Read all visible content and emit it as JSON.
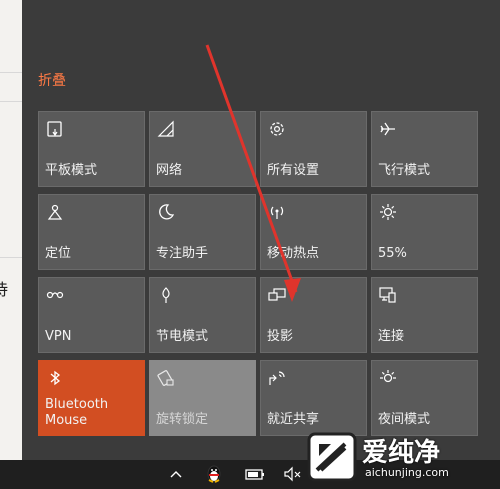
{
  "left_page": {
    "text": "待"
  },
  "panel": {
    "collapse_label": "折叠",
    "tiles": [
      {
        "label": "平板模式",
        "icon": "tablet-mode-icon",
        "state": "normal"
      },
      {
        "label": "网络",
        "icon": "network-icon",
        "state": "normal"
      },
      {
        "label": "所有设置",
        "icon": "settings-gear-icon",
        "state": "normal"
      },
      {
        "label": "飞行模式",
        "icon": "airplane-icon",
        "state": "normal"
      },
      {
        "label": "定位",
        "icon": "location-icon",
        "state": "normal"
      },
      {
        "label": "专注助手",
        "icon": "moon-icon",
        "state": "normal"
      },
      {
        "label": "移动热点",
        "icon": "hotspot-icon",
        "state": "normal"
      },
      {
        "label": "55%",
        "icon": "brightness-icon",
        "state": "normal"
      },
      {
        "label": "VPN",
        "icon": "vpn-icon",
        "state": "normal"
      },
      {
        "label": "节电模式",
        "icon": "battery-saver-icon",
        "state": "normal"
      },
      {
        "label": "投影",
        "icon": "project-icon",
        "state": "normal"
      },
      {
        "label": "连接",
        "icon": "connect-icon",
        "state": "normal"
      },
      {
        "label": "Bluetooth Mouse",
        "icon": "bluetooth-icon",
        "state": "active"
      },
      {
        "label": "旋转锁定",
        "icon": "rotation-lock-icon",
        "state": "disabled"
      },
      {
        "label": "就近共享",
        "icon": "nearby-share-icon",
        "state": "normal"
      },
      {
        "label": "夜间模式",
        "icon": "night-light-icon",
        "state": "normal"
      }
    ]
  },
  "watermark": {
    "chinese": "爱纯净",
    "url": "aichunjing.com"
  },
  "colors": {
    "accent": "#d24e22",
    "tile": "#5a5a5a",
    "panel": "#3b3b3b",
    "arrow": "#e0342c"
  }
}
